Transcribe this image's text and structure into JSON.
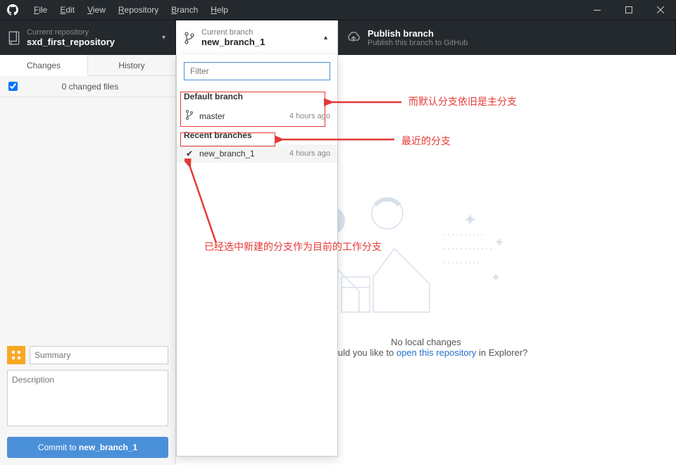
{
  "menu": {
    "file": "File",
    "edit": "Edit",
    "view": "View",
    "repository": "Repository",
    "branch": "Branch",
    "help": "Help"
  },
  "toolbar": {
    "repo": {
      "label": "Current repository",
      "value": "sxd_first_repository"
    },
    "branch": {
      "label": "Current branch",
      "value": "new_branch_1"
    },
    "publish": {
      "label": "Publish branch",
      "value": "Publish this branch to GitHub"
    }
  },
  "tabs": {
    "changes": "Changes",
    "history": "History"
  },
  "changes": {
    "count": "0 changed files"
  },
  "dropdown": {
    "filter_placeholder": "Filter",
    "default_header": "Default branch",
    "default_item": {
      "name": "master",
      "time": "4 hours ago"
    },
    "recent_header": "Recent branches",
    "recent_item": {
      "name": "new_branch_1",
      "time": "4 hours ago"
    }
  },
  "commit": {
    "summary_placeholder": "Summary",
    "description_placeholder": "Description",
    "button_prefix": "Commit to ",
    "button_branch": "new_branch_1"
  },
  "empty": {
    "line1": "No local changes",
    "line2a": "Would you like to ",
    "link": "open this repository",
    "line2b": " in Explorer?"
  },
  "annotations": {
    "a1": "而默认分支依旧是主分支",
    "a2": "最近的分支",
    "a3": "已经选中新建的分支作为目前的工作分支"
  }
}
